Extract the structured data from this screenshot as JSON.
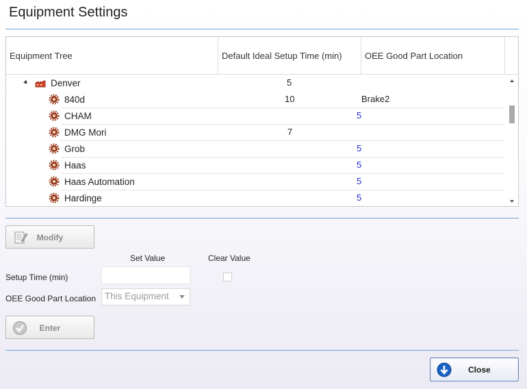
{
  "window": {
    "title": "Equipment Settings"
  },
  "grid": {
    "columns": [
      "Equipment Tree",
      "Default Ideal Setup Time (min)",
      "OEE Good Part Location"
    ],
    "rows": [
      {
        "name": "Denver",
        "level": 0,
        "setup_time": "5",
        "setup_time_inherited": false,
        "location": "",
        "icon": "factory-icon"
      },
      {
        "name": "840d",
        "level": 1,
        "setup_time": "10",
        "setup_time_inherited": false,
        "location": "Brake2",
        "icon": "gear-icon"
      },
      {
        "name": "CHAM",
        "level": 1,
        "setup_time": "5",
        "setup_time_inherited": true,
        "location": "",
        "icon": "gear-icon"
      },
      {
        "name": "DMG Mori",
        "level": 1,
        "setup_time": "7",
        "setup_time_inherited": false,
        "location": "",
        "icon": "gear-icon"
      },
      {
        "name": "Grob",
        "level": 1,
        "setup_time": "5",
        "setup_time_inherited": true,
        "location": "",
        "icon": "gear-icon"
      },
      {
        "name": "Haas",
        "level": 1,
        "setup_time": "5",
        "setup_time_inherited": true,
        "location": "",
        "icon": "gear-icon"
      },
      {
        "name": "Haas Automation",
        "level": 1,
        "setup_time": "5",
        "setup_time_inherited": true,
        "location": "",
        "icon": "gear-icon"
      },
      {
        "name": "Hardinge",
        "level": 1,
        "setup_time": "5",
        "setup_time_inherited": true,
        "location": "",
        "icon": "gear-icon"
      }
    ]
  },
  "modify_button": {
    "label": "Modify",
    "icon": "edit-document-icon"
  },
  "form": {
    "set_value_header": "Set Value",
    "clear_value_header": "Clear Value",
    "setup_time_label": "Setup Time (min)",
    "setup_time_value": "",
    "location_label": "OEE Good Part Location",
    "location_selected": "This Equipment"
  },
  "enter_button": {
    "label": "Enter",
    "icon": "checkmark-circle-icon"
  },
  "close_button": {
    "label": "Close",
    "icon": "arrow-down-circle-icon"
  },
  "colors": {
    "accent_line": "#6fa6d6",
    "inherited_value": "#1d2fc7"
  }
}
